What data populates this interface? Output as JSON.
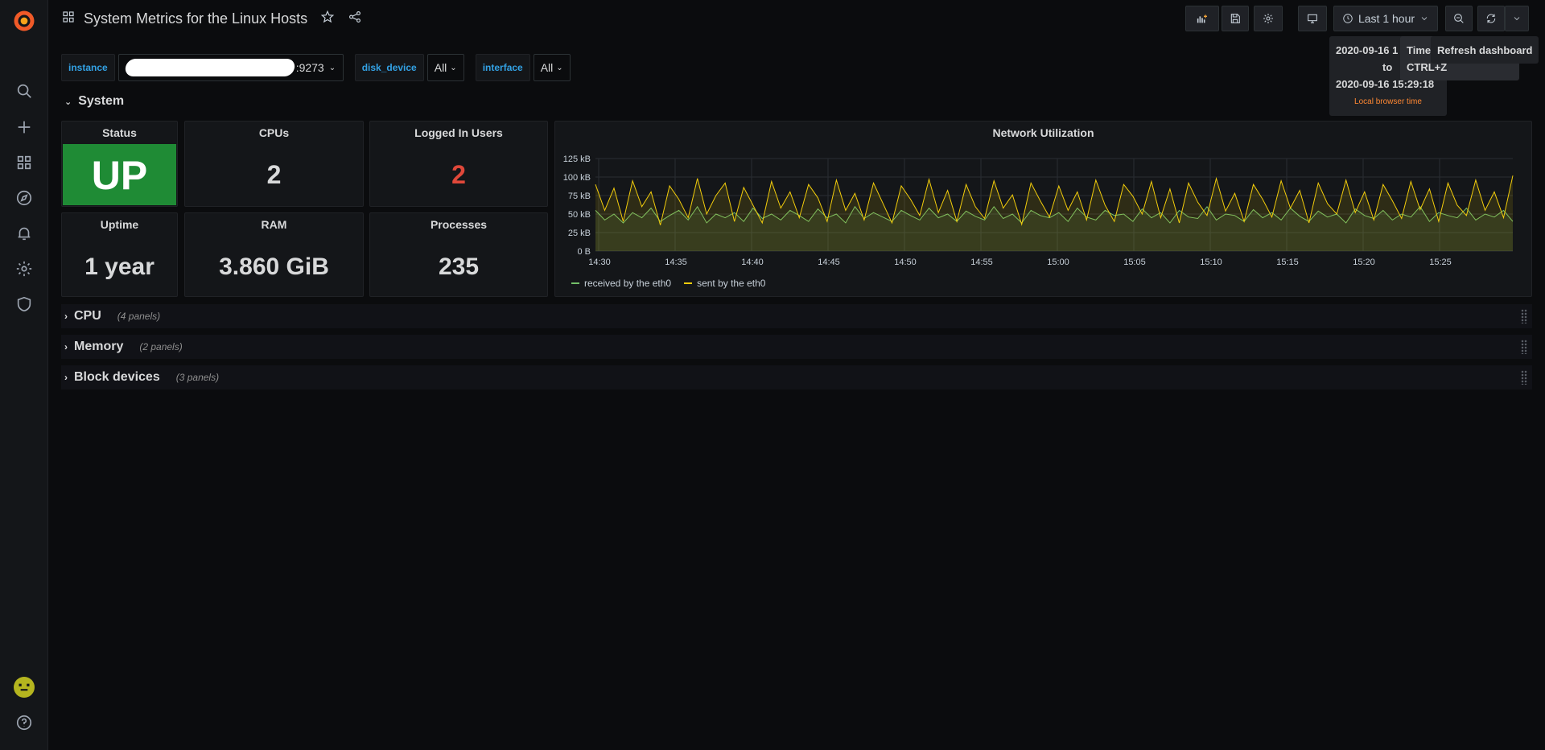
{
  "header": {
    "title": "System Metrics for the Linux Hosts",
    "time_range": "Last 1 hour"
  },
  "variables": [
    {
      "label": "instance",
      "value": ":9273"
    },
    {
      "label": "disk_device",
      "value": "All"
    },
    {
      "label": "interface",
      "value": "All"
    }
  ],
  "rows": {
    "system": {
      "title": "System"
    },
    "cpu": {
      "title": "CPU",
      "count": "(4 panels)"
    },
    "memory": {
      "title": "Memory",
      "count": "(2 panels)"
    },
    "block": {
      "title": "Block devices",
      "count": "(3 panels)"
    }
  },
  "panels": {
    "status": {
      "title": "Status",
      "value": "UP"
    },
    "cpus": {
      "title": "CPUs",
      "value": "2"
    },
    "users": {
      "title": "Logged In Users",
      "value": "2"
    },
    "uptime": {
      "title": "Uptime",
      "value": "1 year"
    },
    "ram": {
      "title": "RAM",
      "value": "3.860 GiB"
    },
    "processes": {
      "title": "Processes",
      "value": "235"
    },
    "network": {
      "title": "Network Utilization"
    }
  },
  "time_tooltip": {
    "from": "2020-09-16 1",
    "to": "to",
    "until": "2020-09-16 15:29:18",
    "note": "Local browser time"
  },
  "shortcut_tooltip": {
    "line1": "Time",
    "line2": "CTRL+Z"
  },
  "refresh_tooltip": {
    "text": "Refresh dashboard"
  },
  "colors": {
    "status_green": "#1f8b35",
    "users_red": "#e0483a",
    "received": "#73bf69",
    "sent": "#f2cc0c",
    "accent_blue": "#33a2e5"
  },
  "chart_data": {
    "type": "line",
    "title": "Network Utilization",
    "ylabel": "",
    "xlabel": "",
    "y_ticks": [
      "0 B",
      "25 kB",
      "50 kB",
      "75 kB",
      "100 kB",
      "125 kB"
    ],
    "x_ticks": [
      "14:30",
      "14:35",
      "14:40",
      "14:45",
      "14:50",
      "14:55",
      "15:00",
      "15:05",
      "15:10",
      "15:15",
      "15:20",
      "15:25"
    ],
    "ylim": [
      0,
      125
    ],
    "legend_position": "bottom-left",
    "series": [
      {
        "name": "received by the eth0",
        "color": "#73bf69",
        "values": [
          55,
          42,
          50,
          38,
          52,
          45,
          58,
          40,
          48,
          55,
          42,
          60,
          38,
          50,
          45,
          52,
          40,
          58,
          44,
          50,
          42,
          55,
          48,
          40,
          57,
          45,
          50,
          38,
          60,
          44,
          52,
          46,
          40,
          55,
          48,
          42,
          58,
          45,
          50,
          40,
          54,
          47,
          42,
          60,
          44,
          50,
          38,
          55,
          48,
          45,
          52,
          40,
          58,
          46,
          42,
          55,
          48,
          50,
          40,
          57,
          45,
          52,
          38,
          55,
          46,
          44,
          60,
          42,
          50,
          48,
          40,
          56,
          45,
          52,
          42,
          58,
          47,
          40,
          54,
          46,
          50,
          38,
          57,
          48,
          44,
          55,
          42,
          50,
          46,
          60,
          40,
          52,
          48,
          45,
          58,
          42,
          50,
          46,
          55,
          40
        ]
      },
      {
        "name": "sent by the eth0",
        "color": "#f2cc0c",
        "values": [
          90,
          55,
          85,
          40,
          95,
          60,
          80,
          35,
          88,
          70,
          45,
          98,
          50,
          75,
          92,
          40,
          86,
          62,
          38,
          94,
          58,
          80,
          45,
          90,
          72,
          40,
          96,
          55,
          78,
          42,
          92,
          65,
          38,
          88,
          70,
          48,
          97,
          52,
          82,
          40,
          90,
          60,
          44,
          95,
          58,
          76,
          36,
          92,
          68,
          46,
          88,
          55,
          80,
          42,
          96,
          62,
          40,
          90,
          74,
          50,
          94,
          45,
          84,
          38,
          92,
          66,
          48,
          98,
          54,
          78,
          40,
          90,
          70,
          46,
          95,
          58,
          82,
          38,
          92,
          64,
          50,
          96,
          52,
          80,
          42,
          90,
          68,
          44,
          94,
          56,
          84,
          40,
          92,
          62,
          48,
          96,
          55,
          80,
          45,
          102
        ]
      }
    ]
  }
}
